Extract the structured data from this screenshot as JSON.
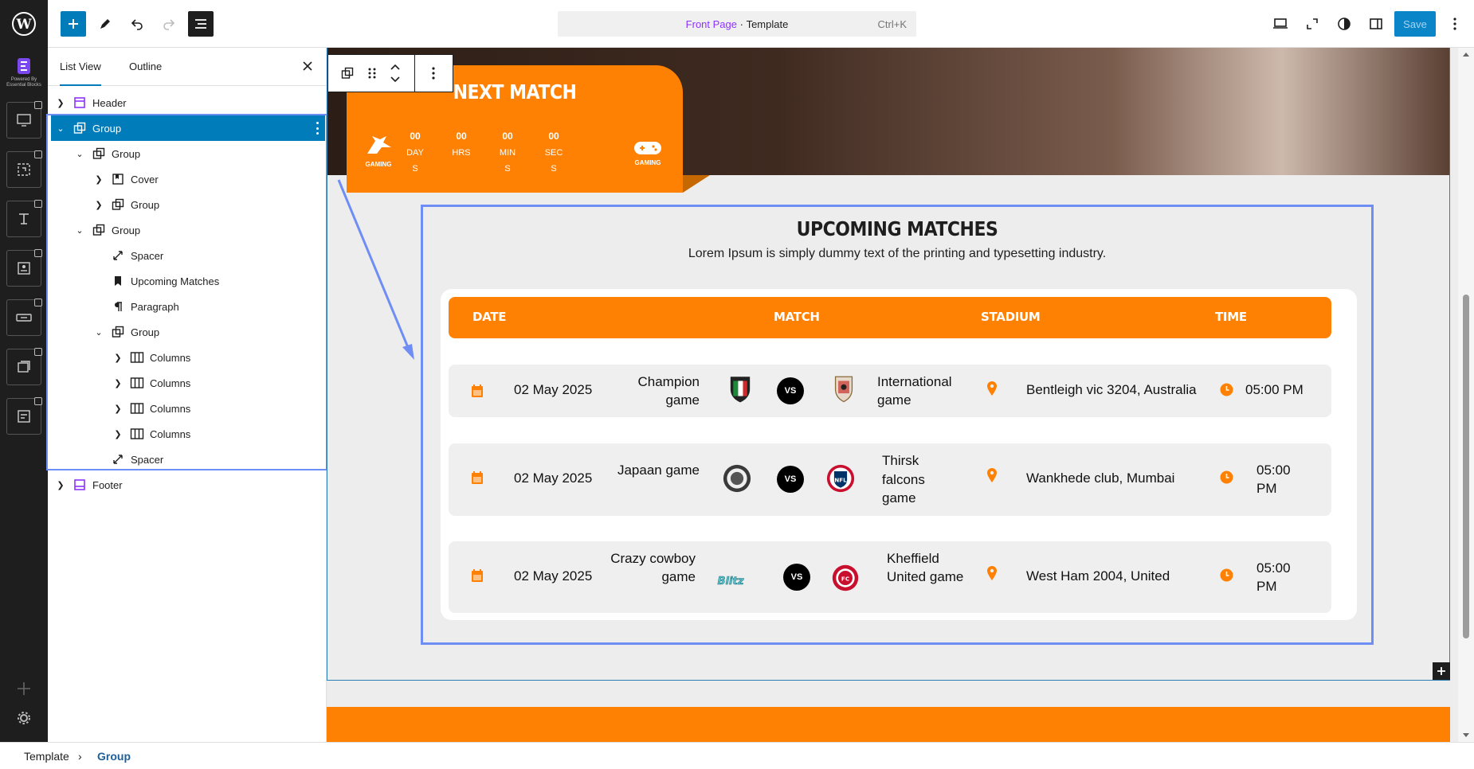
{
  "topbar": {
    "command_template_name": "Front Page",
    "command_separator": " · ",
    "command_template_type": "Template",
    "command_shortcut": "Ctrl+K",
    "save_label": "Save"
  },
  "rail": {
    "brand_caption": "Powered By Essential Blocks"
  },
  "panel": {
    "tabs": [
      "List View",
      "Outline"
    ],
    "tree": [
      {
        "label": "Header",
        "icon": "template-part-icon"
      },
      {
        "label": "Group",
        "icon": "group-icon"
      },
      {
        "label": "Group",
        "icon": "group-icon"
      },
      {
        "label": "Cover",
        "icon": "cover-icon"
      },
      {
        "label": "Group",
        "icon": "group-icon"
      },
      {
        "label": "Group",
        "icon": "group-icon"
      },
      {
        "label": "Spacer",
        "icon": "spacer-icon"
      },
      {
        "label": "Upcoming Matches",
        "icon": "bookmark-icon"
      },
      {
        "label": "Paragraph",
        "icon": "paragraph-icon"
      },
      {
        "label": "Group",
        "icon": "group-icon"
      },
      {
        "label": "Columns",
        "icon": "columns-icon"
      },
      {
        "label": "Columns",
        "icon": "columns-icon"
      },
      {
        "label": "Columns",
        "icon": "columns-icon"
      },
      {
        "label": "Columns",
        "icon": "columns-icon"
      },
      {
        "label": "Spacer",
        "icon": "spacer-icon"
      },
      {
        "label": "Footer",
        "icon": "template-part-icon"
      }
    ]
  },
  "next_match": {
    "title": "NEXT MATCH",
    "gaming_left": "GAMING",
    "gaming_right": "GAMING",
    "countdown": [
      {
        "value": "00",
        "label": "DAYS"
      },
      {
        "value": "00",
        "label": "HRS"
      },
      {
        "value": "00",
        "label": "MINS"
      },
      {
        "value": "00",
        "label": "SECS"
      }
    ]
  },
  "upcoming": {
    "title": "UPCOMING MATCHES",
    "subtitle": "Lorem Ipsum is simply dummy text of the printing and typesetting industry.",
    "headers": {
      "date": "DATE",
      "match": "MATCH",
      "stadium": "STADIUM",
      "time": "TIME"
    },
    "vs_label": "VS",
    "rows": [
      {
        "date": "02 May 2025",
        "team_a": "Champion game",
        "team_b": "International game",
        "stadium": "Bentleigh vic 3204, Australia",
        "time": "05:00 PM"
      },
      {
        "date": "02 May 2025",
        "team_a": "Japaan game",
        "team_b": "Thirsk falcons game",
        "stadium": "Wankhede club, Mumbai",
        "time": "05:00 PM"
      },
      {
        "date": "02 May 2025",
        "team_a": "Crazy cowboy game",
        "team_b": "Kheffield United game",
        "stadium": "West Ham 2004, United",
        "time": "05:00 PM"
      }
    ]
  },
  "breadcrumb": {
    "items": [
      "Template",
      "Group"
    ]
  },
  "colors": {
    "accent": "#007cba",
    "orange": "#ff8103",
    "selection": "#6f8ef5"
  }
}
